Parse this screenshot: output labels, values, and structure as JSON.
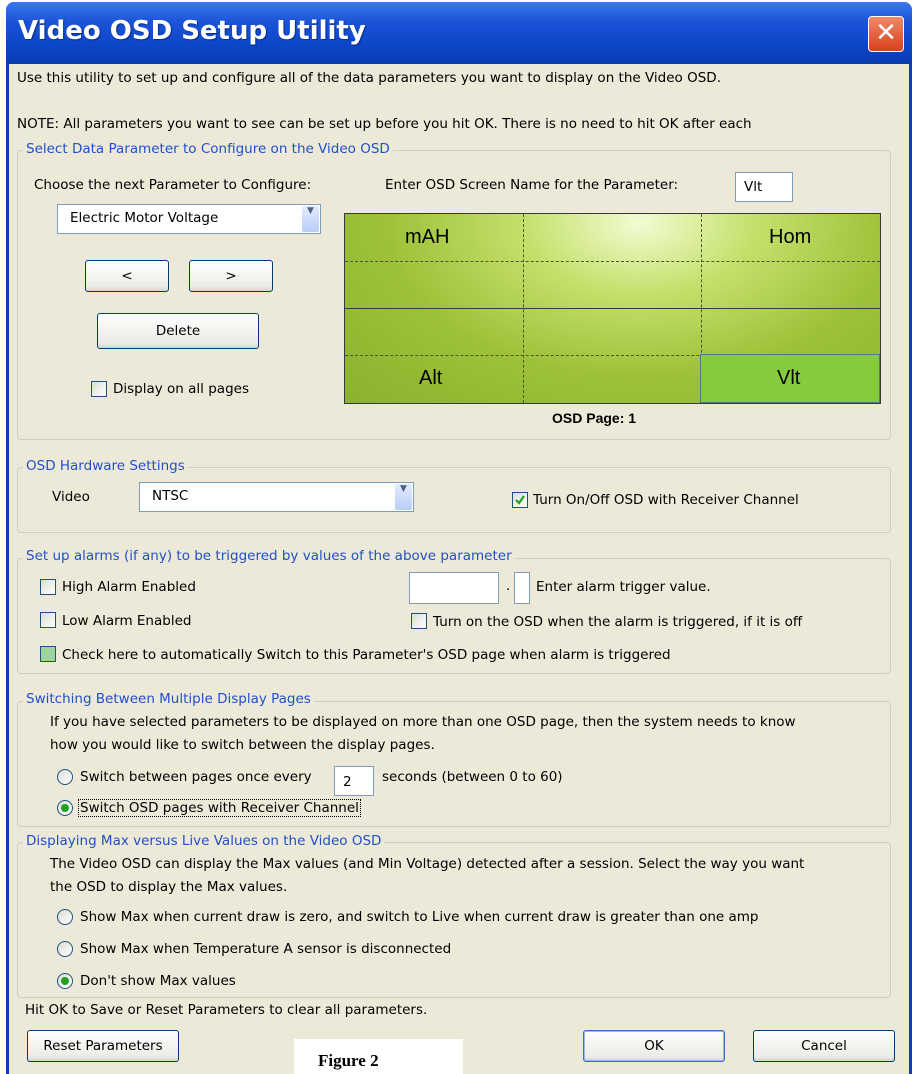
{
  "window": {
    "title": "Video OSD Setup Utility",
    "close_glyph": "✕"
  },
  "intro": {
    "line1": "Use this utility to set up and configure all of the data parameters you want to display on the Video OSD.",
    "line2": "NOTE:  All parameters you want to see can be set up before you hit OK. There is no need to hit OK after each"
  },
  "select_group": {
    "legend": "Select Data Parameter to Configure on the Video OSD",
    "choose_label": "Choose the next Parameter to Configure:",
    "screen_name_label": "Enter OSD Screen Name for the Parameter:",
    "screen_name_value": "Vlt",
    "parameter_selected": "Electric Motor Voltage",
    "prev_label": "<",
    "next_label": ">",
    "delete_label": "Delete",
    "display_all_label": "Display on all pages",
    "display_all_checked": false,
    "osd_cells": {
      "top_left": "mAH",
      "top_right": "Hom",
      "bottom_left": "Alt",
      "bottom_right": "Vlt"
    },
    "osd_page_label": "OSD Page: 1"
  },
  "hardware_group": {
    "legend": "OSD Hardware Settings",
    "video_label": "Video",
    "video_value": "NTSC",
    "receiver_label": "Turn On/Off OSD with Receiver Channel",
    "receiver_checked": true
  },
  "alarm_group": {
    "legend": "Set up alarms (if any) to be triggered by values of the above parameter",
    "high_label": "High Alarm Enabled",
    "low_label": "Low Alarm Enabled",
    "trigger_value": "",
    "trigger_decimal_sep": ".",
    "trigger_label": "Enter alarm trigger value.",
    "turn_on_label": "Turn on the OSD when the alarm is triggered, if it is off",
    "switch_label": "Check here to automatically Switch to this Parameter's OSD page when alarm is triggered"
  },
  "switching_group": {
    "legend": "Switching Between Multiple Display Pages",
    "desc1": "If you have selected parameters to be displayed on more than one OSD page, then the system needs to know",
    "desc2": "how you would like to switch between the display pages.",
    "opt1_prefix": "Switch between pages once every",
    "opt1_value": "2",
    "opt1_suffix": "seconds (between 0 to 60)",
    "opt2_label": "Switch OSD pages with Receiver Channel",
    "selected": 2
  },
  "maxlive_group": {
    "legend": "Displaying Max versus Live Values on the Video OSD",
    "desc1": "The Video OSD can display the Max values (and Min Voltage) detected after a session. Select the way you want",
    "desc2": "the OSD to display the Max values.",
    "opt1": "Show Max when current draw is zero, and switch to Live when current draw is greater than one amp",
    "opt2": "Show Max when Temperature A sensor is disconnected",
    "opt3": "Don't show Max values",
    "selected": 3
  },
  "footer": {
    "hint": "Hit OK to Save or Reset Parameters to clear all parameters.",
    "reset_label": "Reset Parameters",
    "ok_label": "OK",
    "cancel_label": "Cancel"
  },
  "figure_caption": "Figure 2"
}
